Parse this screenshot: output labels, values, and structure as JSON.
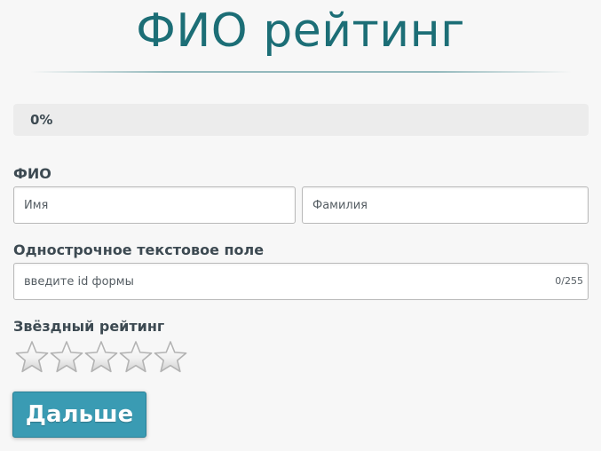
{
  "page": {
    "title": "ФИО рейтинг"
  },
  "progress": {
    "label": "0%",
    "value_percent": 0
  },
  "fio_field": {
    "label": "ФИО",
    "first_name_placeholder": "Имя",
    "first_name_value": "",
    "last_name_placeholder": "Фамилия",
    "last_name_value": ""
  },
  "text_field": {
    "label": "Однострочное текстовое поле",
    "placeholder": "введите id формы",
    "value": "",
    "counter": "0/255"
  },
  "rating": {
    "label": "Звёздный рейтинг",
    "max_stars": 5,
    "selected": 0,
    "icon": "star-icon"
  },
  "next_button": {
    "label": "Дальше"
  },
  "colors": {
    "accent": "#3a9bb3",
    "title": "#1c6e76",
    "text": "#3d4a52",
    "background": "#f7f7f7"
  }
}
